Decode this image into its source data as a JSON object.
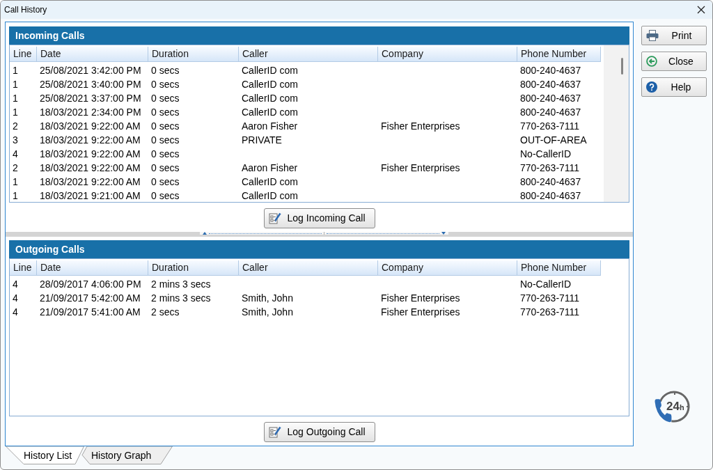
{
  "window": {
    "title": "Call History"
  },
  "incoming_calls": {
    "title": "Incoming Calls",
    "columns": [
      "Line",
      "Date",
      "Duration",
      "Caller",
      "Company",
      "Phone Number"
    ],
    "rows": [
      {
        "line": "1",
        "date": "25/08/2021 3:42:00 PM",
        "duration": "0 secs",
        "caller": "CallerID com",
        "phone_number": "800-240-4637"
      },
      {
        "line": "1",
        "date": "25/08/2021 3:40:00 PM",
        "duration": "0 secs",
        "caller": "CallerID com",
        "phone_number": "800-240-4637"
      },
      {
        "line": "1",
        "date": "25/08/2021 3:37:00 PM",
        "duration": "0 secs",
        "caller": "CallerID com",
        "phone_number": "800-240-4637"
      },
      {
        "line": "1",
        "date": "18/03/2021 2:34:00 PM",
        "duration": "0 secs",
        "caller": "CallerID com",
        "phone_number": "800-240-4637"
      },
      {
        "line": "2",
        "date": "18/03/2021 9:22:00 AM",
        "duration": "0 secs",
        "caller": "Aaron Fisher",
        "company": "Fisher Enterprises",
        "phone_number": "770-263-7111"
      },
      {
        "line": "3",
        "date": "18/03/2021 9:22:00 AM",
        "duration": "0 secs",
        "caller": "PRIVATE",
        "phone_number": "OUT-OF-AREA"
      },
      {
        "line": "4",
        "date": "18/03/2021 9:22:00 AM",
        "duration": "0 secs",
        "phone_number": "No-CallerID"
      },
      {
        "line": "2",
        "date": "18/03/2021 9:22:00 AM",
        "duration": "0 secs",
        "caller": "Aaron Fisher",
        "company": "Fisher Enterprises",
        "phone_number": "770-263-7111"
      },
      {
        "line": "1",
        "date": "18/03/2021 9:22:00 AM",
        "duration": "0 secs",
        "caller": "CallerID com",
        "phone_number": "800-240-4637"
      },
      {
        "line": "1",
        "date": "18/03/2021 9:21:00 AM",
        "duration": "0 secs",
        "caller": "CallerID com",
        "phone_number": "800-240-4637"
      }
    ],
    "button": "Log Incoming Call"
  },
  "outgoing_calls": {
    "title": "Outgoing Calls",
    "columns": [
      "Line",
      "Date",
      "Duration",
      "Caller",
      "Company",
      "Phone Number"
    ],
    "rows": [
      {
        "line": "4",
        "date": "28/09/2017 4:06:00 PM",
        "duration": "2 mins 3 secs",
        "phone_number": "No-CallerID"
      },
      {
        "line": "4",
        "date": "21/09/2017 5:42:00 AM",
        "duration": "2 mins 3 secs",
        "caller": "Smith, John",
        "company": "Fisher Enterprises",
        "phone_number": "770-263-7111"
      },
      {
        "line": "4",
        "date": "21/09/2017 5:41:00 AM",
        "duration": "2 secs",
        "caller": "Smith, John",
        "company": "Fisher Enterprises",
        "phone_number": "770-263-7111"
      }
    ],
    "button": "Log Outgoing Call"
  },
  "side_buttons": [
    {
      "kind": "print",
      "label": "Print"
    },
    {
      "kind": "close",
      "label": "Close"
    },
    {
      "kind": "help",
      "label": "Help"
    }
  ],
  "logo": {
    "hours": "24",
    "unit": "h"
  },
  "tabs": [
    {
      "label": "History List",
      "selected": true
    },
    {
      "label": "History Graph",
      "selected": false
    }
  ]
}
